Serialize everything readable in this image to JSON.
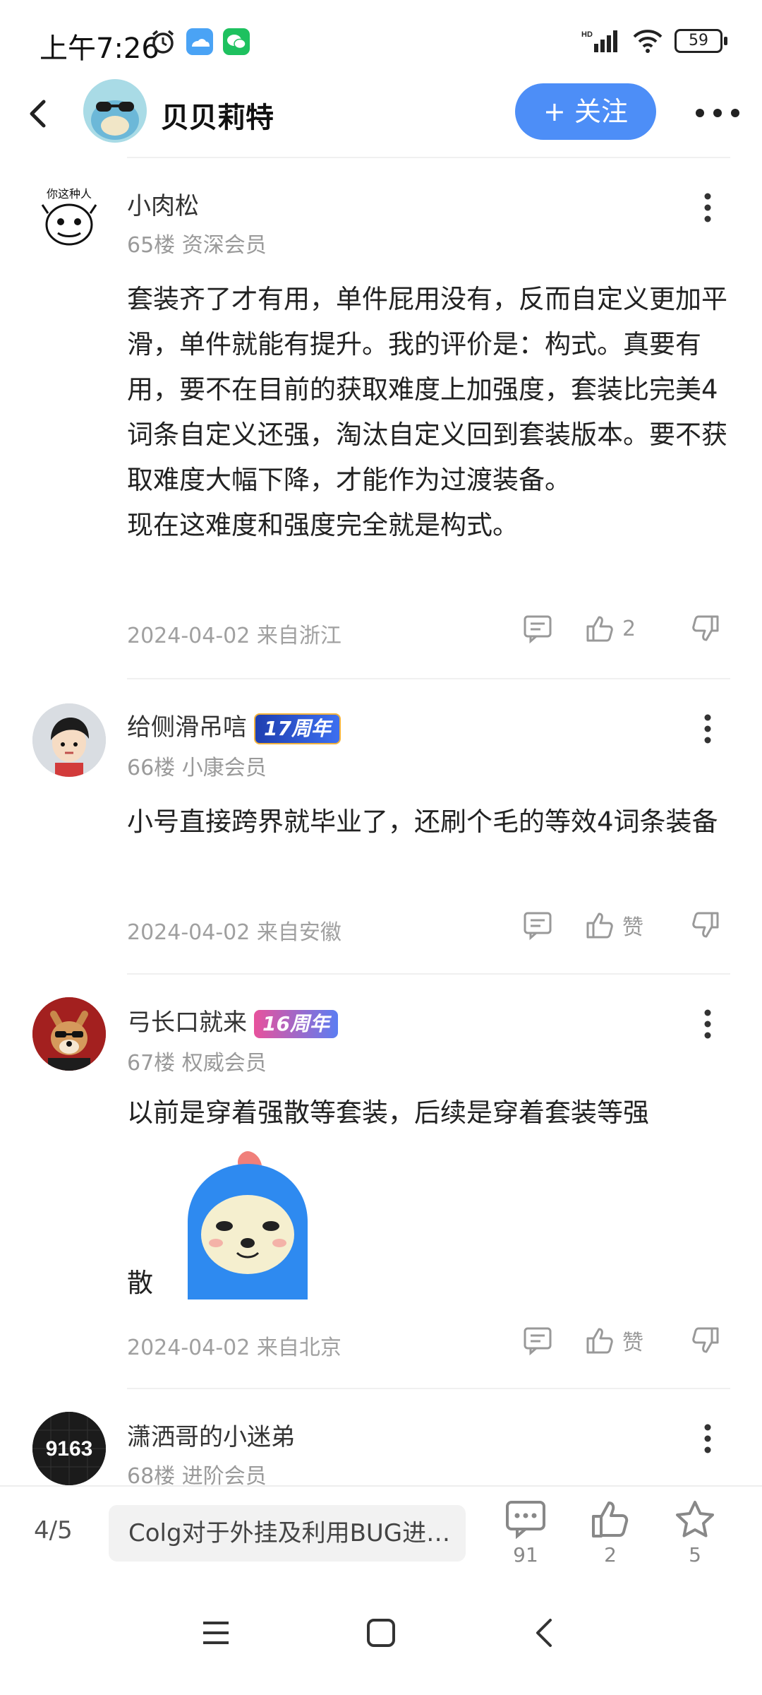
{
  "status_bar": {
    "time": "上午7:26",
    "battery": "59"
  },
  "header": {
    "title": "贝贝莉特",
    "follow_label": "+ 关注"
  },
  "comments": [
    {
      "username": "小肉松",
      "floor": "65楼",
      "level": "资深会员",
      "body": [
        "套装齐了才有用，单件屁用没有，反而自定义更加平滑，单件就能有提升。我的评价是：构式。真要有用，要不在目前的获取难度上加强度，套装比完美4词条自定义还强，淘汰自定义回到套装版本。要不获取难度大幅下降，才能作为过渡装备。",
        "现在这难度和强度完全就是构式。"
      ],
      "date_location": "2024-04-02 来自浙江",
      "like_label": "2",
      "avatar_text": "你这种人"
    },
    {
      "username": "给侧滑吊唁",
      "badge": "17周年",
      "floor": "66楼",
      "level": "小康会员",
      "body": [
        "小号直接跨界就毕业了，还刷个毛的等效4词条装备"
      ],
      "date_location": "2024-04-02 来自安徽",
      "like_label": "赞"
    },
    {
      "username": "弓长口就来",
      "badge": "16周年",
      "floor": "67楼",
      "level": "权威会员",
      "body": [
        "以前是穿着强散等套装，后续是穿着套装等强"
      ],
      "trailing_text": "散",
      "date_location": "2024-04-02 来自北京",
      "like_label": "赞"
    },
    {
      "username": "潇洒哥的小迷弟",
      "floor": "68楼",
      "level": "进阶会员",
      "avatar_text": "9163"
    }
  ],
  "bottom_bar": {
    "page_indicator": "4/5",
    "thread_title": "Colg对于外挂及利用BUG进…",
    "comment_count": "91",
    "like_count": "2",
    "favorite_count": "5"
  },
  "colors": {
    "accent": "#4d8ef7",
    "badge17": "#2b56d6",
    "badge16": "#e8529c"
  }
}
